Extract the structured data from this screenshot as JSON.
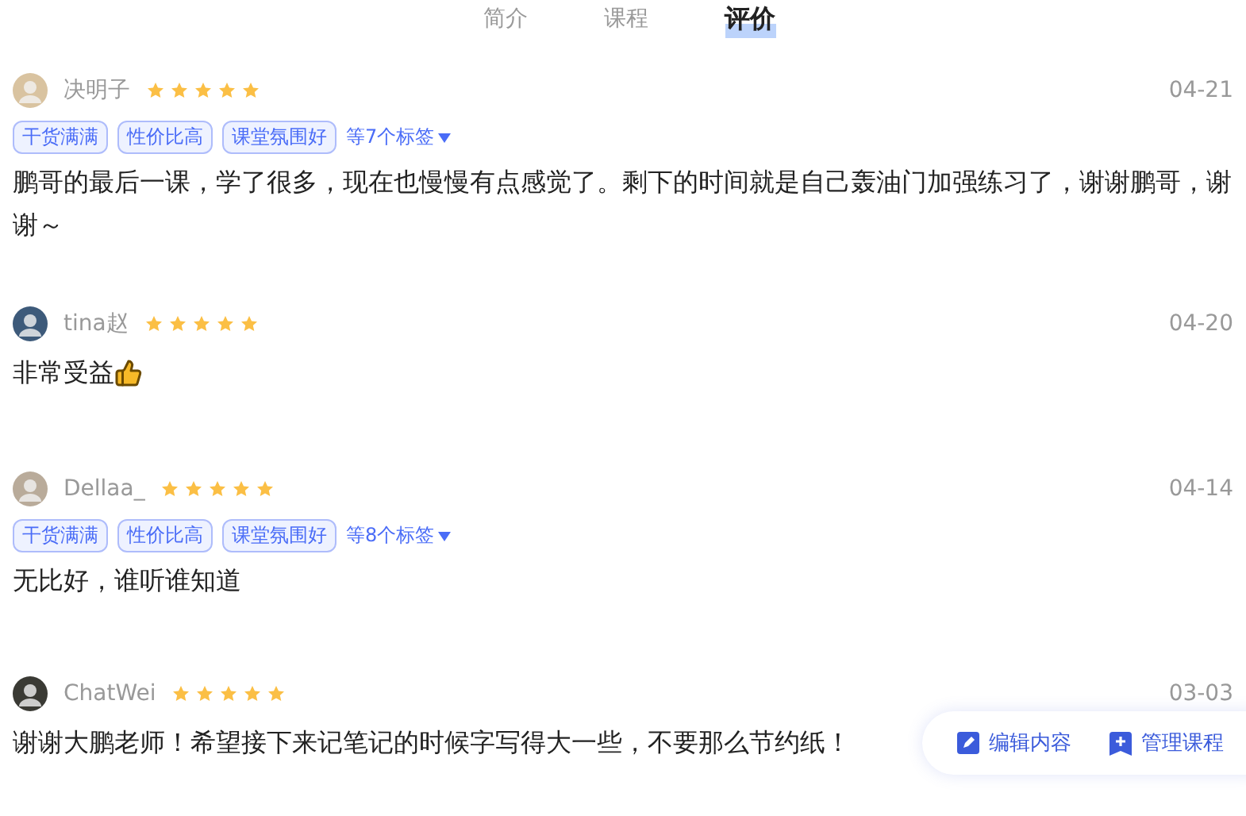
{
  "tabs": [
    {
      "label": "简介",
      "selected": false
    },
    {
      "label": "课程",
      "selected": false
    },
    {
      "label": "评价",
      "selected": true
    }
  ],
  "reviews": [
    {
      "user": "决明子",
      "stars": 5,
      "date": "04-21",
      "tags": [
        "干货满满",
        "性价比高",
        "课堂氛围好"
      ],
      "more_tags": "等7个标签",
      "text": "鹏哥的最后一课，学了很多，现在也慢慢有点感觉了。剩下的时间就是自己轰油门加强练习了，谢谢鹏哥，谢谢～"
    },
    {
      "user": "tina赵",
      "stars": 5,
      "date": "04-20",
      "text": "非常受益",
      "thumbs_up": true
    },
    {
      "user": "Dellaa_",
      "stars": 5,
      "date": "04-14",
      "tags": [
        "干货满满",
        "性价比高",
        "课堂氛围好"
      ],
      "more_tags": "等8个标签",
      "text": "无比好，谁听谁知道"
    },
    {
      "user": "ChatWei",
      "stars": 5,
      "date": "03-03",
      "text": "谢谢大鹏老师！希望接下来记笔记的时候字写得大一些，不要那么节约纸！"
    }
  ],
  "actions": [
    {
      "kind": "edit",
      "label": "编辑内容"
    },
    {
      "kind": "add",
      "label": "管理课程"
    }
  ]
}
